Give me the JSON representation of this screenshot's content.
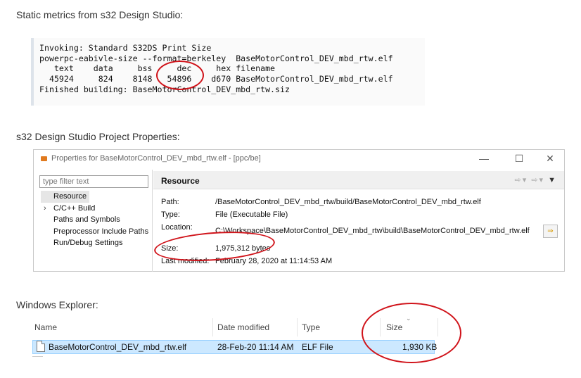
{
  "headings": {
    "static_metrics": "Static metrics from s32 Design Studio:",
    "project_properties": "s32 Design Studio Project Properties:",
    "windows_explorer": "Windows Explorer:"
  },
  "console": {
    "lines": [
      "Invoking: Standard S32DS Print Size",
      "powerpc-eabivle-size --format=berkeley  BaseMotorControl_DEV_mbd_rtw.elf",
      "   text    data     bss     dec     hex filename",
      "  45924     824    8148   54896    d670 BaseMotorControl_DEV_mbd_rtw.elf",
      "Finished building: BaseMotorControl_DEV_mbd_rtw.siz"
    ]
  },
  "properties_window": {
    "title": "Properties for BaseMotorControl_DEV_mbd_rtw.elf - [ppc/be]",
    "filter_placeholder": "type filter text",
    "tree": [
      {
        "label": "Resource",
        "selected": true,
        "expandable": false
      },
      {
        "label": "C/C++ Build",
        "selected": false,
        "expandable": true
      },
      {
        "label": "Paths and Symbols",
        "selected": false,
        "expandable": false
      },
      {
        "label": "Preprocessor Include Paths",
        "selected": false,
        "expandable": false
      },
      {
        "label": "Run/Debug Settings",
        "selected": false,
        "expandable": false
      }
    ],
    "section_title": "Resource",
    "path_label": "Path:",
    "path_value": "/BaseMotorControl_DEV_mbd_rtw/build/BaseMotorControl_DEV_mbd_rtw.elf",
    "type_label": "Type:",
    "type_value": "File  (Executable File)",
    "location_label": "Location:",
    "location_value": "C:\\Workspace\\BaseMotorControl_DEV_mbd_rtw\\build\\BaseMotorControl_DEV_mbd_rtw.elf",
    "size_label": "Size:",
    "size_value": "1,975,312  bytes",
    "modified_label": "Last modified:",
    "modified_value": "February 28, 2020 at 11:14:53 AM"
  },
  "explorer": {
    "columns": {
      "name": "Name",
      "date": "Date modified",
      "type": "Type",
      "size": "Size"
    },
    "row": {
      "name": "BaseMotorControl_DEV_mbd_rtw.elf",
      "date": "28-Feb-20 11:14 AM",
      "type": "ELF File",
      "size": "1,930 KB"
    }
  },
  "colors": {
    "annotation": "#d0131a",
    "selection": "#cce8ff"
  }
}
